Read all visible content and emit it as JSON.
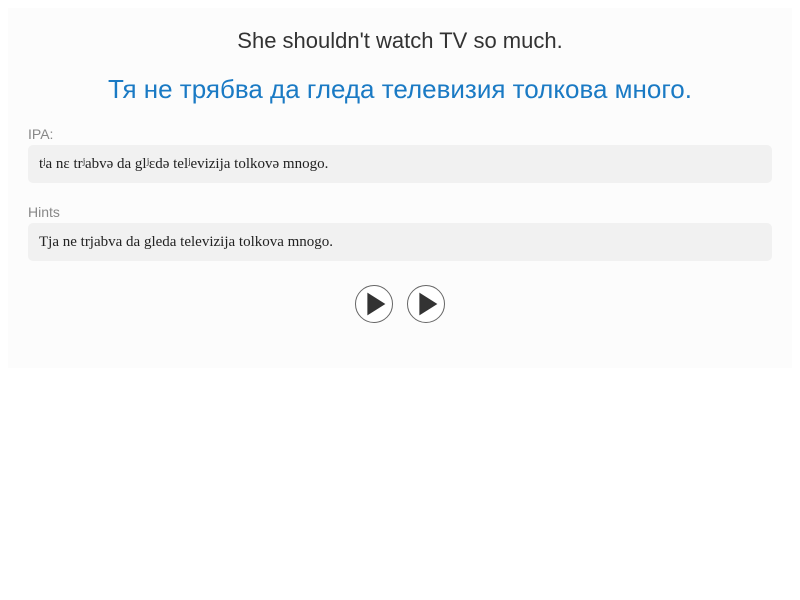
{
  "sentence": {
    "english": "She shouldn't watch TV so much.",
    "translation": "Тя не трябва да гледа телевизия толкова много."
  },
  "ipa": {
    "label": "IPA:",
    "text": "tʲa nɛ trʲabvə da glʲɛdə telʲevizija tolkovə mnogo."
  },
  "hints": {
    "label": "Hints",
    "text": "Tja ne trjabva da gleda televizija tolkova mnogo."
  },
  "controls": {
    "buttons": [
      {
        "icon": "play-icon"
      },
      {
        "icon": "play-icon"
      }
    ]
  },
  "colors": {
    "translation": "#1a7ac4",
    "box_background": "#f1f1f1"
  }
}
